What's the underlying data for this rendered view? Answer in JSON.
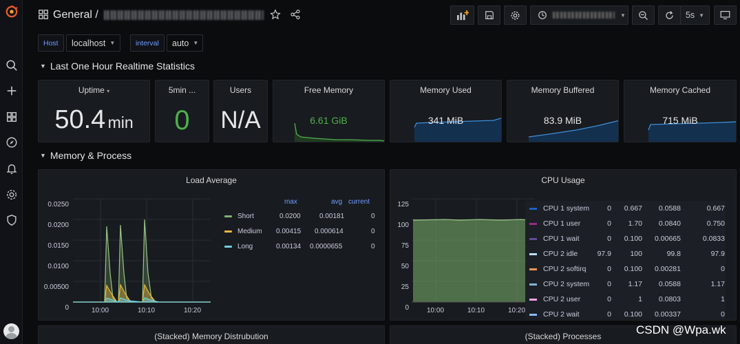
{
  "header": {
    "dashboard_title": "General /",
    "refresh_interval": "5s"
  },
  "sidebar": {
    "icons": [
      "grafana-logo-icon",
      "search-icon",
      "plus-icon",
      "dashboards-icon",
      "explore-icon",
      "alerting-bell-icon",
      "settings-gear-icon",
      "shield-icon",
      "user-avatar"
    ]
  },
  "variables": [
    {
      "label": "Host",
      "value": "localhost"
    },
    {
      "label": "interval",
      "value": "auto"
    }
  ],
  "rows": {
    "realtime": "Last One Hour Realtime Statistics",
    "memory_process": "Memory & Process"
  },
  "stats": {
    "uptime": {
      "title": "Uptime",
      "value": "50.4",
      "unit": "min"
    },
    "load5": {
      "title": "5min ...",
      "value": "0"
    },
    "users": {
      "title": "Users",
      "value": "N/A"
    },
    "free_memory": {
      "title": "Free Memory",
      "value": "6.61 GiB"
    },
    "memory_used": {
      "title": "Memory Used",
      "value": "341 MiB"
    },
    "memory_buffered": {
      "title": "Memory Buffered",
      "value": "83.9 MiB"
    },
    "memory_cached": {
      "title": "Memory Cached",
      "value": "715 MiB"
    }
  },
  "load_average": {
    "title": "Load Average",
    "columns": [
      "max",
      "avg",
      "current"
    ],
    "y_ticks": [
      "0.0250",
      "0.0200",
      "0.0150",
      "0.0100",
      "0.00500",
      "0"
    ],
    "x_ticks": [
      "10:00",
      "10:10",
      "10:20"
    ],
    "legend": [
      {
        "name": "Short",
        "max": "0.0200",
        "avg": "0.00181",
        "current": "0",
        "color": "#7eb26d"
      },
      {
        "name": "Medium",
        "max": "0.00415",
        "avg": "0.000614",
        "current": "0",
        "color": "#eab839"
      },
      {
        "name": "Long",
        "max": "0.00134",
        "avg": "0.0000655",
        "current": "0",
        "color": "#6ed0e0"
      }
    ]
  },
  "cpu_usage": {
    "title": "CPU Usage",
    "y_ticks": [
      "125",
      "100",
      "75",
      "50",
      "25",
      "0"
    ],
    "x_ticks": [
      "10:00",
      "10:10",
      "10:20"
    ],
    "legend": [
      {
        "name": "CPU 1 system",
        "c1": "0",
        "c2": "0.667",
        "c3": "0.0588",
        "c4": "0.667",
        "color": "#1f60c4"
      },
      {
        "name": "CPU 1 user",
        "c1": "0",
        "c2": "1.70",
        "c3": "0.0840",
        "c4": "0.750",
        "color": "#962d82"
      },
      {
        "name": "CPU 1 wait",
        "c1": "0",
        "c2": "0.100",
        "c3": "0.00665",
        "c4": "0.0833",
        "color": "#614d93"
      },
      {
        "name": "CPU 2 idle",
        "c1": "97.9",
        "c2": "100",
        "c3": "99.8",
        "c4": "97.9",
        "color": "#badff4"
      },
      {
        "name": "CPU 2 softirq",
        "c1": "0",
        "c2": "0.100",
        "c3": "0.00281",
        "c4": "0",
        "color": "#f9934e"
      },
      {
        "name": "CPU 2 system",
        "c1": "0",
        "c2": "1.17",
        "c3": "0.0588",
        "c4": "1.17",
        "color": "#82b5d8"
      },
      {
        "name": "CPU 2 user",
        "c1": "0",
        "c2": "1",
        "c3": "0.0803",
        "c4": "1",
        "color": "#f5a3e6"
      },
      {
        "name": "CPU 2 wait",
        "c1": "0",
        "c2": "0.100",
        "c3": "0.00337",
        "c4": "0",
        "color": "#8ab8ff"
      }
    ]
  },
  "bottom_panels": {
    "memory_distribution": "(Stacked) Memory Distrubution",
    "processes": "(Stacked) Processes"
  },
  "watermark": "CSDN @Wpa.wk"
}
